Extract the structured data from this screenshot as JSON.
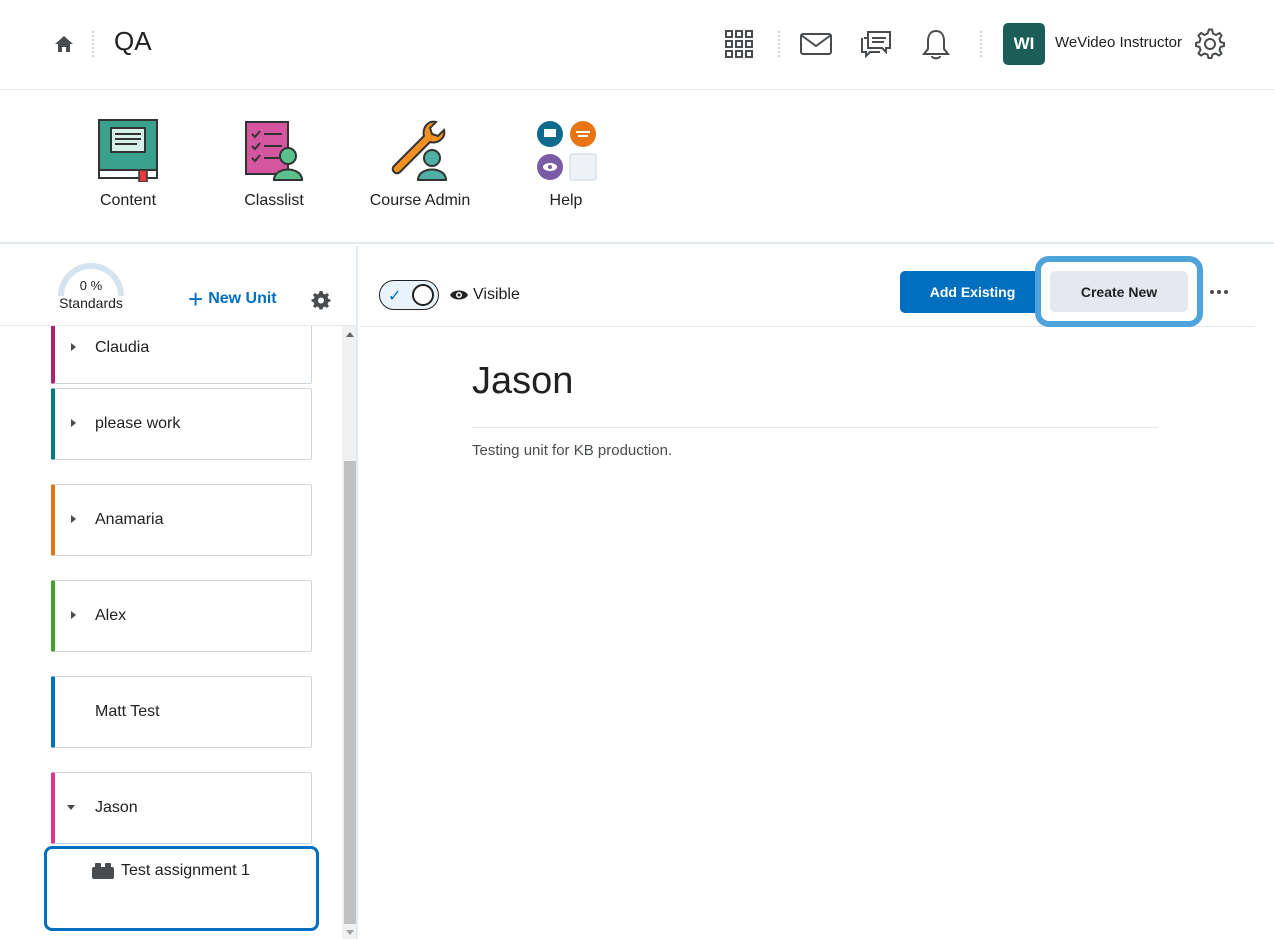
{
  "header": {
    "course_title": "QA",
    "user_initials": "WI",
    "user_name": "WeVideo Instructor",
    "icons": [
      "home-icon",
      "app-grid-icon",
      "mail-icon",
      "chat-icon",
      "bell-icon",
      "gear-icon"
    ]
  },
  "navbar": {
    "items": [
      {
        "label": "Content",
        "icon": "content-book-icon"
      },
      {
        "label": "Classlist",
        "icon": "classlist-icon"
      },
      {
        "label": "Course Admin",
        "icon": "course-admin-wrench-icon"
      },
      {
        "label": "Help",
        "icon": "help-icon"
      }
    ]
  },
  "sidebar": {
    "standards_percent": "0 %",
    "standards_label": "Standards",
    "new_unit_label": "New Unit",
    "units": [
      {
        "name": "Claudia",
        "color": "#b0226e",
        "expandable": true
      },
      {
        "name": "please work",
        "color": "#007b80",
        "expandable": true
      },
      {
        "name": "Anamaria",
        "color": "#e87511",
        "expandable": true
      },
      {
        "name": "Alex",
        "color": "#46a12d",
        "expandable": true
      },
      {
        "name": "Matt Test",
        "color": "#006fbf",
        "expandable": false
      },
      {
        "name": "Jason",
        "color": "#e0358c",
        "expandable": true,
        "expanded": true,
        "selected": true
      }
    ],
    "assignment": "Test assignment 1"
  },
  "toolbar": {
    "visibility_label": "Visible",
    "add_existing_label": "Add Existing",
    "create_new_label": "Create New"
  },
  "unit": {
    "title": "Jason",
    "description": "Testing unit for KB production."
  },
  "colors": {
    "primary": "#006fbf",
    "highlight_ring": "#4fa3db",
    "avatar_bg": "#1b5e57"
  }
}
